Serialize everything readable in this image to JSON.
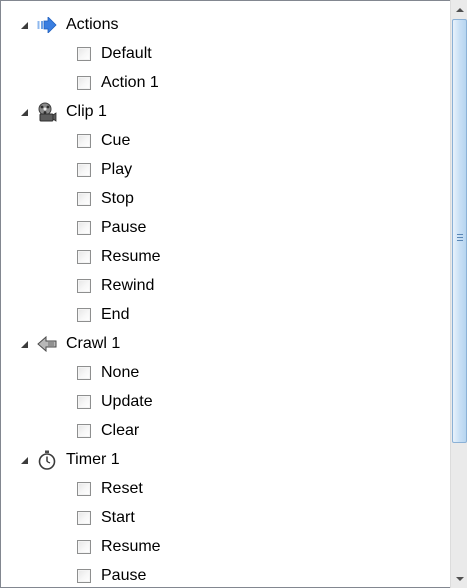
{
  "colors": {
    "checkbox_border": "#8e8f8f",
    "scrollbar_thumb": "#c9e0f5",
    "actions_icon": "#3a7ee0"
  },
  "groups": [
    {
      "label": "Actions",
      "icon": "arrow-right-icon",
      "items": [
        {
          "label": "Default",
          "checked": false
        },
        {
          "label": "Action 1",
          "checked": false
        }
      ]
    },
    {
      "label": "Clip 1",
      "icon": "film-reel-icon",
      "items": [
        {
          "label": "Cue",
          "checked": false
        },
        {
          "label": "Play",
          "checked": false
        },
        {
          "label": "Stop",
          "checked": false
        },
        {
          "label": "Pause",
          "checked": false
        },
        {
          "label": "Resume",
          "checked": false
        },
        {
          "label": "Rewind",
          "checked": false
        },
        {
          "label": "End",
          "checked": false
        }
      ]
    },
    {
      "label": "Crawl 1",
      "icon": "arrow-left-icon",
      "items": [
        {
          "label": "None",
          "checked": false
        },
        {
          "label": "Update",
          "checked": false
        },
        {
          "label": "Clear",
          "checked": false
        }
      ]
    },
    {
      "label": "Timer 1",
      "icon": "stopwatch-icon",
      "items": [
        {
          "label": "Reset",
          "checked": false
        },
        {
          "label": "Start",
          "checked": false
        },
        {
          "label": "Resume",
          "checked": false
        },
        {
          "label": "Pause",
          "checked": false
        }
      ]
    }
  ]
}
